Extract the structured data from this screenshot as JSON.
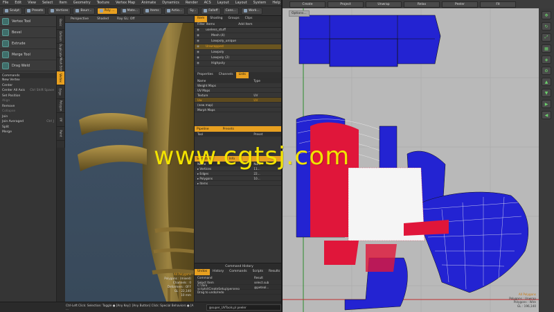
{
  "menubar": [
    "File",
    "Edit",
    "View",
    "Select",
    "Item",
    "Geometry",
    "Texture",
    "Vertex Map",
    "Animate",
    "Dynamics",
    "Render",
    "ACS",
    "Layout",
    "Layout",
    "System",
    "Help"
  ],
  "toolbar": {
    "sculpt": "Sculpt",
    "presets": "Presets",
    "vertices": "Vertices",
    "boundary": "Bourr...",
    "polygons": "Poly ...",
    "material": "Mate...",
    "items": "Items",
    "action": "Actio...",
    "sy": "Sy...",
    "falloff": "Falloff",
    "snap": "Cons...",
    "work": "Work..."
  },
  "tools": [
    {
      "label": "Vertex Tool"
    },
    {
      "label": "Bevel"
    },
    {
      "label": "Extrude"
    },
    {
      "label": "Merge Tool"
    },
    {
      "label": "Drag Weld"
    }
  ],
  "commands": {
    "header": "Commands",
    "items": [
      {
        "label": "New Vertex",
        "key": "",
        "dim": false
      },
      {
        "label": "Center",
        "key": "",
        "dim": false
      },
      {
        "label": "Center All Axis",
        "key": "Ctrl Shift Space",
        "dim": false
      },
      {
        "label": "Set Position",
        "key": "",
        "dim": false
      },
      {
        "label": "Align",
        "key": "",
        "dim": true
      },
      {
        "label": "Remove",
        "key": "",
        "dim": false
      },
      {
        "label": "Collapse",
        "key": "",
        "dim": true
      },
      {
        "label": "Join",
        "key": "",
        "dim": false
      },
      {
        "label": "Join Averaged",
        "key": "Ctrl J",
        "dim": false
      },
      {
        "label": "Split",
        "key": "",
        "dim": false
      },
      {
        "label": "Merge",
        "key": "",
        "dim": false
      }
    ]
  },
  "vtabs": [
    "Basic",
    "Deform",
    "Duplicate",
    "Mesh Edit",
    "Vertex",
    "Edge",
    "Polygon",
    "UV",
    "Paint"
  ],
  "viewport3d": {
    "head": [
      "Perspective",
      "Shaded",
      "Ray GL: Off"
    ],
    "info": [
      "All Polygons",
      "Polygons : (mixed)",
      "Channels : 0",
      "Deformers : OFF",
      "GL : 22,140",
      "10 mm"
    ]
  },
  "rightpanel": {
    "tabs": [
      "Item",
      "Shading",
      "Groups",
      "Clips"
    ],
    "filter": "Filter Items",
    "add_item": "Add Item",
    "items": [
      {
        "label": "useless_stuff",
        "sel": false
      },
      {
        "label": "Mesh (4)",
        "sel": false
      },
      {
        "label": "Lowpoly_unique",
        "sel": false
      },
      {
        "label": "Unwrapped",
        "sel": true
      },
      {
        "label": "Lowpoly",
        "sel": false
      },
      {
        "label": "Lowpoly (2)",
        "sel": false
      },
      {
        "label": "Highpoly",
        "sel": false
      }
    ],
    "prop_tabs": [
      "Properties",
      "Channels",
      "Lists"
    ],
    "list_head": [
      "Name",
      "Type"
    ],
    "lists": [
      {
        "name": "Weight Maps",
        "type": "",
        "sel": false
      },
      {
        "name": "UV Maps",
        "type": "",
        "sel": false
      },
      {
        "name": "Texture",
        "type": "UV",
        "sel": false
      },
      {
        "name": "Uw",
        "type": "UV",
        "sel": true
      },
      {
        "name": "(new map)",
        "type": "",
        "sel": false
      },
      {
        "name": "Morph Maps",
        "type": "",
        "sel": false
      }
    ],
    "pipeline": "Pipeline",
    "presets": "Presets",
    "pipe_head": [
      "Tool",
      "Preset"
    ],
    "statistics": "Statistics",
    "info_tab": "Info",
    "stats_head": [
      "Name",
      "Num"
    ],
    "stats": [
      {
        "name": "Vertices",
        "num": "11..."
      },
      {
        "name": "Edges",
        "num": "22..."
      },
      {
        "name": "Polygons",
        "num": "10..."
      },
      {
        "name": "Items",
        "num": ""
      }
    ],
    "history_title": "Command History",
    "history_tabs": [
      "Undos",
      "History",
      "Commands",
      "Scripts",
      "Results"
    ],
    "history_head": [
      "Command",
      "Result"
    ],
    "history_rows": [
      {
        "cmd": "Select Item",
        "res": "select.sub"
      },
      {
        "cmd": "C:\\Toro scripts\\ICreateSetup\\perseno",
        "res": "@peteal..."
      },
      {
        "cmd": "Drag to undo/redo",
        "res": ""
      }
    ]
  },
  "statusbar": {
    "hint": "Ctrl-Left Click: Selection: Toggle ● [Any Key]: [Any Button] Click: Special Behaviors ● [A ...",
    "cmdline": "@super_UVTools.pl peeler"
  },
  "uv": {
    "buttons": [
      "Create",
      "Project",
      "Unwrap",
      "Relax",
      "Peeler",
      "Fit"
    ],
    "options": "Options...",
    "info": [
      "All Polygons",
      "Polygons : Unwrap",
      "Polygons : Wire",
      "GL : 196,140"
    ],
    "colors": {
      "island": "#2323d2",
      "selected": "#e0163a",
      "background": "#b9b9b9"
    }
  },
  "watermark": "www.cgtsj.com"
}
